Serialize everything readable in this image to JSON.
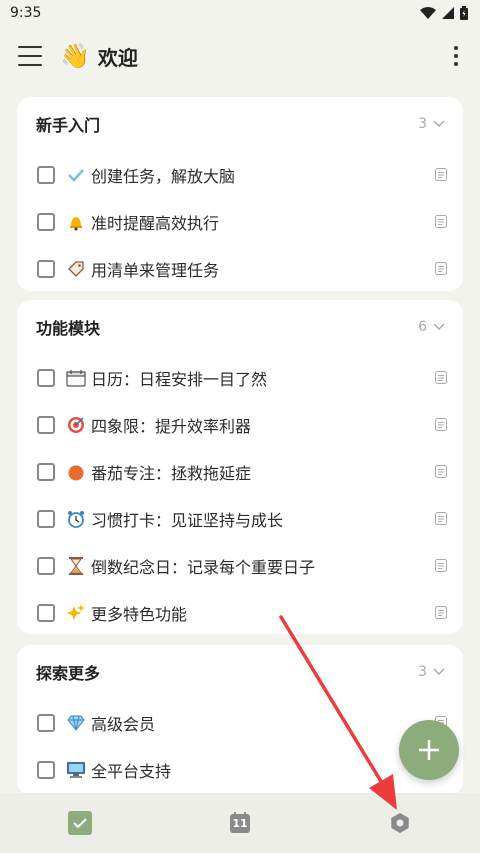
{
  "status": {
    "time": "9:35"
  },
  "header": {
    "emoji": "👋",
    "title": "欢迎"
  },
  "sections": [
    {
      "title": "新手入门",
      "count": "3",
      "items": [
        {
          "icon": "✔",
          "label": "创建任务，解放大脑"
        },
        {
          "icon": "🔔",
          "label": "准时提醒高效执行"
        },
        {
          "icon": "🏷",
          "label": "用清单来管理任务"
        }
      ]
    },
    {
      "title": "功能模块",
      "count": "6",
      "items": [
        {
          "icon": "📅",
          "label": "日历：日程安排一目了然"
        },
        {
          "icon": "🎯",
          "label": "四象限：提升效率利器"
        },
        {
          "icon": "🍅",
          "label": "番茄专注：拯救拖延症"
        },
        {
          "icon": "⏰",
          "label": "习惯打卡：见证坚持与成长"
        },
        {
          "icon": "⏳",
          "label": "倒数纪念日：记录每个重要日子"
        },
        {
          "icon": "✨",
          "label": "更多特色功能"
        }
      ]
    },
    {
      "title": "探索更多",
      "count": "3",
      "items": [
        {
          "icon": "💎",
          "label": "高级会员"
        },
        {
          "icon": "💻",
          "label": "全平台支持"
        }
      ]
    }
  ],
  "bottom_nav": {
    "calendar_day": "11"
  },
  "colors": {
    "accent": "#8dac7c",
    "arrow": "#ee3b3b",
    "background": "#f1f3ec"
  }
}
